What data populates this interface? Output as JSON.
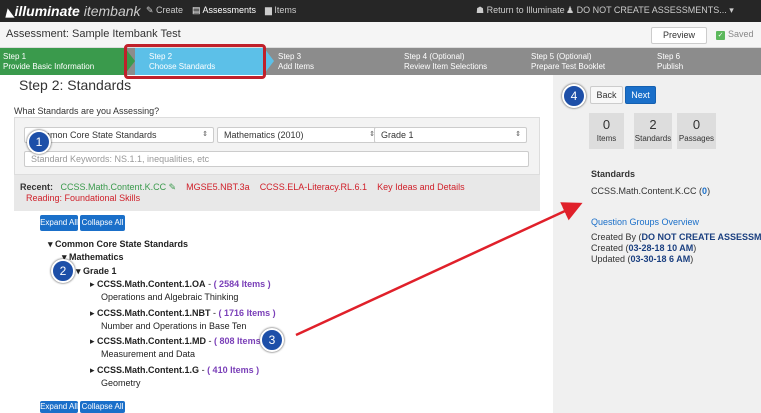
{
  "topbar": {
    "brand_main": "illuminate",
    "brand_sub": " itembank",
    "create": "✎ Create",
    "assessments": "▤ Assessments",
    "items": "▆ Items",
    "return": "☗ Return to Illuminate",
    "user": "♟ DO NOT CREATE ASSESSMENTS... ▾"
  },
  "header": {
    "title": "Assessment: Sample Itembank Test",
    "preview": "Preview",
    "saved": "Saved"
  },
  "steps": [
    {
      "n": "Step 1",
      "label": "Provide Basic Information"
    },
    {
      "n": "Step 2",
      "label": "Choose Standards"
    },
    {
      "n": "Step 3",
      "label": "Add Items"
    },
    {
      "n": "Step 4 (Optional)",
      "label": "Review Item Selections"
    },
    {
      "n": "Step 5 (Optional)",
      "label": "Prepare Test Booklet"
    },
    {
      "n": "Step 6",
      "label": "Publish"
    }
  ],
  "main": {
    "heading": "Step 2: Standards",
    "question": "What Standards are you Assessing?",
    "sel1": "Common Core State Standards",
    "sel2": "Mathematics (2010)",
    "sel3": "Grade 1",
    "keywords_placeholder": "Standard Keywords: NS.1.1, inequalities, etc",
    "recent_label": "Recent:",
    "recent": [
      "CCSS.Math.Content.K.CC ✎",
      "MGSE5.NBT.3a",
      "CCSS.ELA-Literacy.RL.6.1",
      "Key Ideas and Details",
      "Reading: Foundational Skills"
    ],
    "expand": "Expand All",
    "collapse": "Collapse All",
    "tree_root": "▾  Common Core State Standards",
    "tree_subject": "▾  Mathematics",
    "tree_grade": "▾  Grade 1",
    "standards": [
      {
        "code": "CCSS.Math.Content.1.OA",
        "count": "( 2584 Items )",
        "desc": "Operations and Algebraic Thinking"
      },
      {
        "code": "CCSS.Math.Content.1.NBT",
        "count": "( 1716 Items )",
        "desc": "Number and Operations in Base Ten"
      },
      {
        "code": "CCSS.Math.Content.1.MD",
        "count": "( 808 Items )",
        "desc": "Measurement and Data"
      },
      {
        "code": "CCSS.Math.Content.1.G",
        "count": "( 410 Items )",
        "desc": "Geometry"
      }
    ]
  },
  "side": {
    "back": "Back",
    "next": "Next",
    "stats": [
      {
        "num": "0",
        "label": "Items"
      },
      {
        "num": "2",
        "label": "Standards"
      },
      {
        "num": "0",
        "label": "Passages"
      }
    ],
    "standards_heading": "Standards",
    "standard_item": "CCSS.Math.Content.K.CC (",
    "standard_count": "0",
    "standard_close": ")",
    "qgo": "Question Groups Overview",
    "created_by_label": "Created By (",
    "created_by": "DO NOT CREATE ASSESSMENTS,",
    "created_label": "Created (",
    "created": "03-28-18 10 AM",
    "updated_label": "Updated (",
    "updated": "03-30-18 6 AM",
    "paren": ")"
  },
  "badges": [
    "1",
    "2",
    "3",
    "4"
  ],
  "colors": {
    "accent": "#1a6fc9",
    "step_done": "#3a9a4c",
    "step_current": "#5cc0e8",
    "highlight": "#c0202a",
    "arrow": "#e0202a"
  }
}
